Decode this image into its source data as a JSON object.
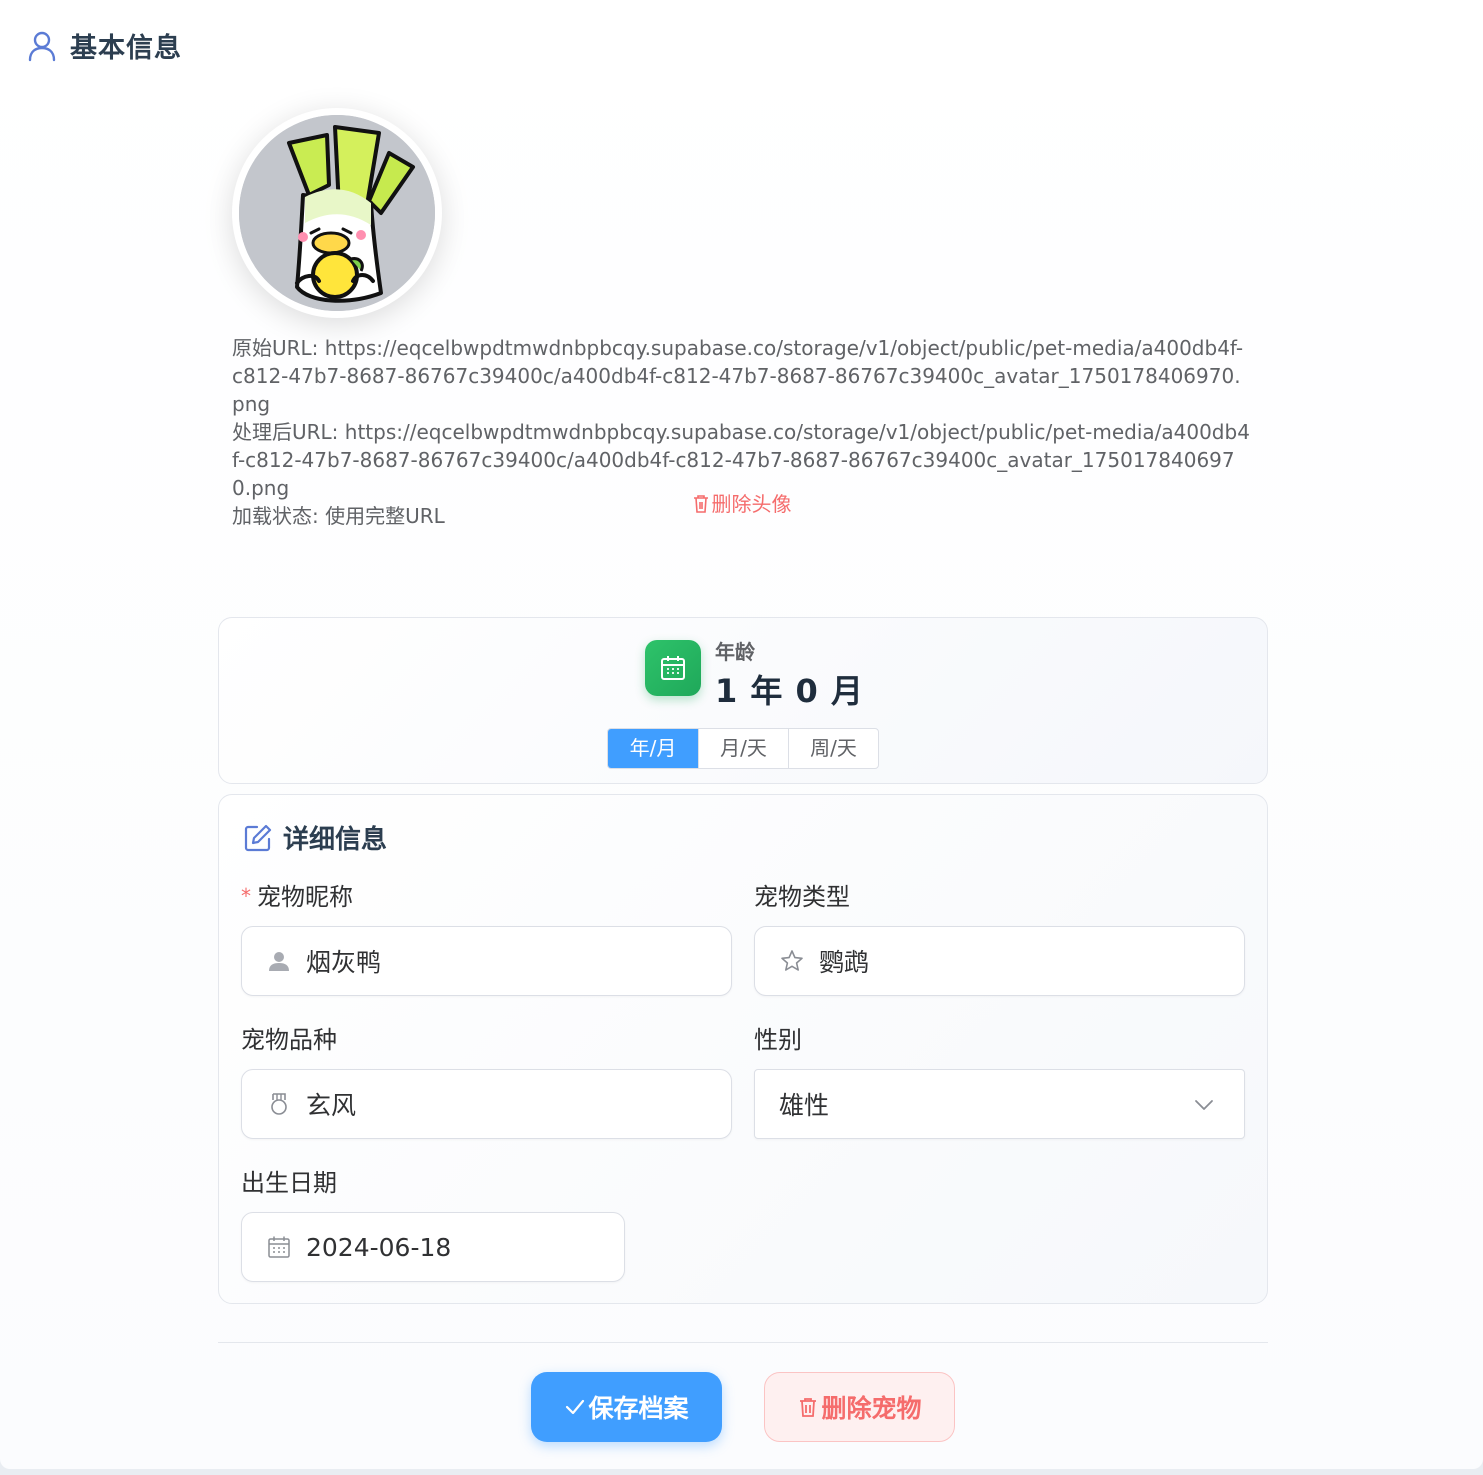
{
  "header": {
    "title": "基本信息",
    "icon": "user-icon"
  },
  "avatar": {
    "alt": "pet avatar"
  },
  "url_info": {
    "original": "原始URL: https://eqcelbwpdtmwdnbpbcqy.supabase.co/storage/v1/object/public/pet-media/a400db4f-c812-47b7-8687-86767c39400c/a400db4f-c812-47b7-8687-86767c39400c_avatar_1750178406970.png",
    "processed": "处理后URL: https://eqcelbwpdtmwdnbpbcqy.supabase.co/storage/v1/object/public/pet-media/a400db4f-c812-47b7-8687-86767c39400c/a400db4f-c812-47b7-8687-86767c39400c_avatar_1750178406970.png",
    "status": "加载状态: 使用完整URL"
  },
  "delete_avatar_label": "删除头像",
  "age": {
    "label": "年龄",
    "value": "1 年 0 月",
    "tabs": [
      {
        "label": "年/月",
        "active": true
      },
      {
        "label": "月/天",
        "active": false
      },
      {
        "label": "周/天",
        "active": false
      }
    ],
    "accent": "#2ec36a"
  },
  "details": {
    "title": "详细信息",
    "required_mark": "*",
    "nickname": {
      "label": "宠物昵称",
      "value": "烟灰鸭",
      "icon": "user-icon"
    },
    "type": {
      "label": "宠物类型",
      "value": "鹦鹉",
      "icon": "star-icon"
    },
    "breed": {
      "label": "宠物品种",
      "value": "玄风",
      "icon": "medal-icon"
    },
    "gender": {
      "label": "性别",
      "value": "雄性",
      "icon": "chevron-down-icon"
    },
    "birth": {
      "label": "出生日期",
      "value": "2024-06-18",
      "icon": "calendar-icon"
    }
  },
  "actions": {
    "save_label": "保存档案",
    "delete_label": "删除宠物"
  },
  "colors": {
    "primary": "#409eff",
    "danger": "#f56c6c"
  }
}
